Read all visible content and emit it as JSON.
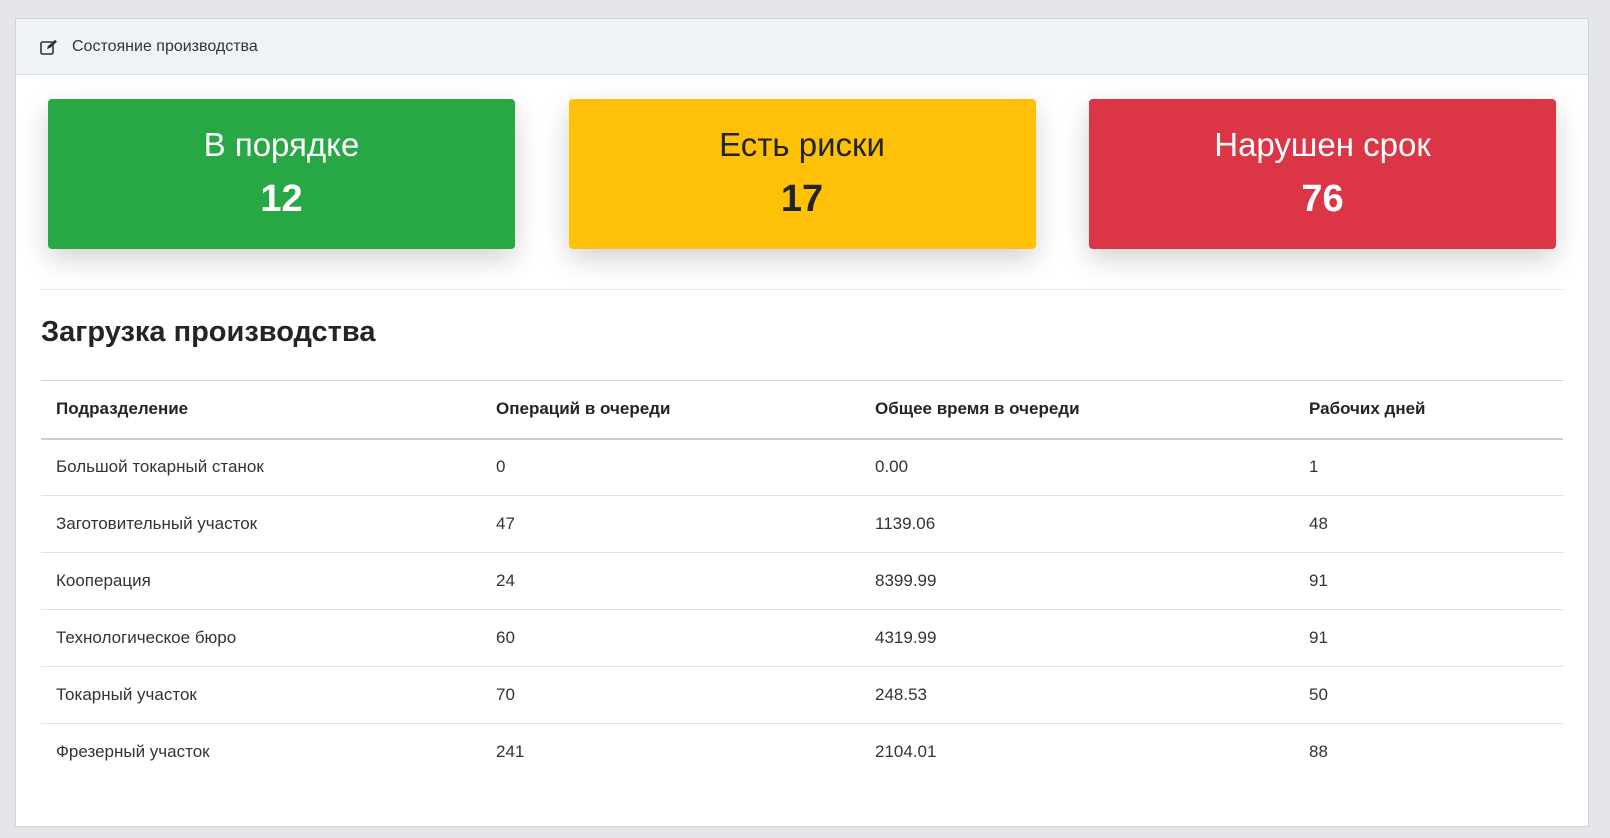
{
  "header": {
    "icon": "edit-icon",
    "title": "Состояние производства"
  },
  "cards": [
    {
      "label": "В порядке",
      "value": "12",
      "color": "#28a745"
    },
    {
      "label": "Есть риски",
      "value": "17",
      "color": "#ffc107"
    },
    {
      "label": "Нарушен срок",
      "value": "76",
      "color": "#dc3545"
    }
  ],
  "load": {
    "title": "Загрузка производства",
    "columns": [
      "Подразделение",
      "Операций в очереди",
      "Общее время в очереди",
      "Рабочих дней"
    ],
    "rows": [
      [
        "Большой токарный станок",
        "0",
        "0.00",
        "1"
      ],
      [
        "Заготовительный участок",
        "47",
        "1139.06",
        "48"
      ],
      [
        "Кооперация",
        "24",
        "8399.99",
        "91"
      ],
      [
        "Технологическое бюро",
        "60",
        "4319.99",
        "91"
      ],
      [
        "Токарный участок",
        "70",
        "248.53",
        "50"
      ],
      [
        "Фрезерный участок",
        "241",
        "2104.01",
        "88"
      ]
    ]
  }
}
